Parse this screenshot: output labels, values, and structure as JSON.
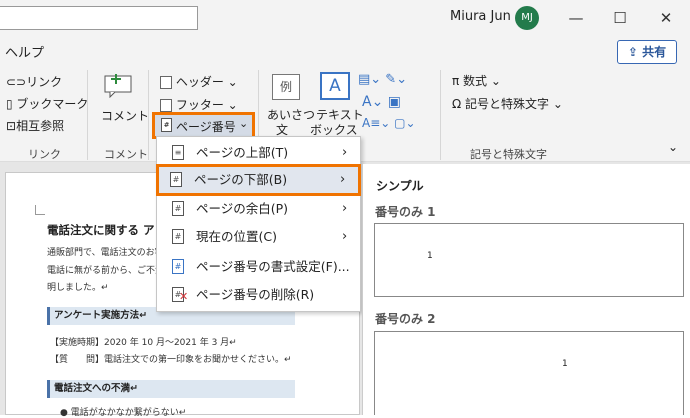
{
  "titlebar": {
    "user_name": "Miura Jun",
    "avatar_initials": "MJ",
    "minimize": "—",
    "maximize": "☐",
    "close": "✕"
  },
  "tab": {
    "label": "ヘルプ"
  },
  "share": {
    "label": "共有"
  },
  "ribbon": {
    "link": "リンク",
    "bookmark": "ブックマーク",
    "cross_ref": "相互参照",
    "group_link": "リンク",
    "comment": "コメント",
    "group_comment": "コメント",
    "header": "ヘッダー",
    "footer": "フッター",
    "page_number": "ページ番号",
    "greeting_line1": "あいさつ",
    "greeting_line2": "文",
    "textbox_line1": "テキスト",
    "textbox_line2": "ボックス",
    "example": "例",
    "equation": "数式",
    "symbols": "記号と特殊文字",
    "group_symbols": "記号と特殊文字",
    "group_text_partial": "ト"
  },
  "menu": {
    "items": [
      {
        "label": "ページの上部(T)",
        "arrow": "›"
      },
      {
        "label": "ページの下部(B)",
        "arrow": "›"
      },
      {
        "label": "ページの余白(P)",
        "arrow": "›"
      },
      {
        "label": "現在の位置(C)",
        "arrow": "›"
      },
      {
        "label": "ページ番号の書式設定(F)..."
      },
      {
        "label": "ページ番号の削除(R)"
      }
    ]
  },
  "gallery": {
    "section": "シンプル",
    "item1_title": "番号のみ 1",
    "item1_number": "1",
    "item2_title": "番号のみ 2",
    "item2_number": "1"
  },
  "document": {
    "heading": "電話注文に関する ア",
    "line1": "通販部門で、電話注文のお客",
    "line2": "電話に無がる前から、ご不満",
    "line3": "明しました。↵",
    "section1": "アンケート実施方法↵",
    "period": "【実施時期】2020 年 10 月～2021 年 3 月↵",
    "question": "【質　　問】電話注文での第一印象をお聞かせください。↵",
    "section2": "電話注文への不満↵",
    "bullet": "電話がなかなか繋がらない↵"
  }
}
